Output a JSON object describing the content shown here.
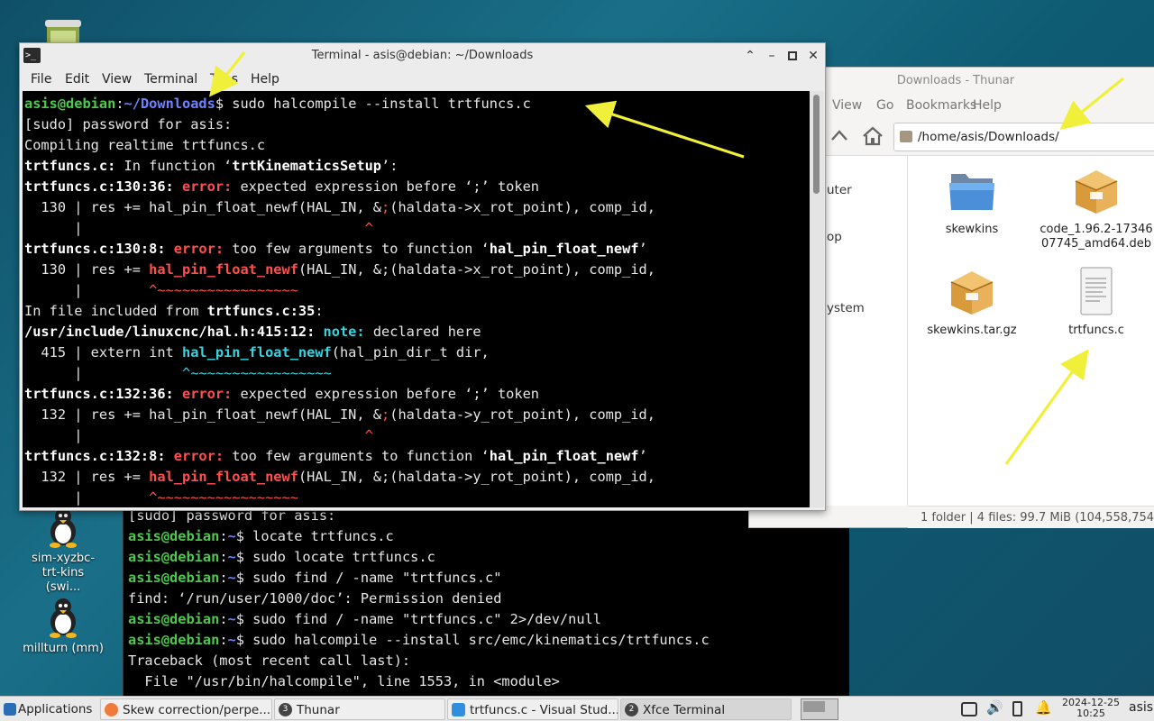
{
  "terminal": {
    "title": "Terminal - asis@debian: ~/Downloads",
    "menu": [
      "File",
      "Edit",
      "View",
      "Terminal",
      "Tabs",
      "Help"
    ]
  },
  "thunar": {
    "title": "Downloads - Thunar",
    "menu": [
      "View",
      "Go",
      "Bookmarks",
      "Help"
    ],
    "path": "/home/asis/Downloads/",
    "sidebar": [
      "uter",
      "op",
      "ystem"
    ],
    "files": [
      {
        "name": "skewkins",
        "icon": "folder-icon"
      },
      {
        "name": "code_1.96.2-1734607745_amd64.deb",
        "display": "code_1.96.2-17346\n07745_amd64.deb",
        "icon": "package-icon"
      },
      {
        "name": "skewkins.tar.gz",
        "icon": "package-icon"
      },
      {
        "name": "trtfuncs.c",
        "icon": "text-file-icon"
      }
    ],
    "status": "1 folder  |  4 files: 99.7 MiB (104,558,754"
  },
  "desktop_icons": [
    {
      "label": "sim-xyzbc-trt-kins (swi..."
    },
    {
      "label": "millturn (mm)"
    }
  ],
  "taskbar": {
    "applications": "Applications",
    "items": [
      {
        "label": "Skew correction/perpe...",
        "icon": "firefox-icon"
      },
      {
        "label": "Thunar",
        "badge": "3"
      },
      {
        "label": "trtfuncs.c - Visual Stud...",
        "icon": "vscode-icon"
      },
      {
        "label": "Xfce Terminal",
        "badge": "2"
      }
    ],
    "date": "2024-12-25",
    "time": "10:25",
    "user": "asis"
  },
  "colors": {
    "prompt_user": "#4ec94e",
    "prompt_path": "#6f82ff",
    "error": "#ff4f4f",
    "note": "#38d3e0",
    "arrow": "#f0f03a"
  },
  "terminal_lines": [
    [
      [
        "asis@debian",
        "g"
      ],
      [
        ":",
        ""
      ],
      [
        "~/Downloads",
        "b"
      ],
      [
        "$ sudo halcompile --install trtfuncs.c",
        ""
      ]
    ],
    [
      [
        "[sudo] password for asis:",
        ""
      ]
    ],
    [
      [
        "Compiling realtime trtfuncs.c",
        ""
      ]
    ],
    [
      [
        "trtfuncs.c:",
        "bw"
      ],
      [
        " In function ‘",
        ""
      ],
      [
        "trtKinematicsSetup",
        "bw"
      ],
      [
        "’:",
        ""
      ]
    ],
    [
      [
        "trtfuncs.c:130:36: ",
        "bw"
      ],
      [
        "error:",
        "r"
      ],
      [
        " expected expression before ‘;’ token",
        ""
      ]
    ],
    [
      [
        "  130 | res += hal_pin_float_newf(HAL_IN, &",
        ""
      ],
      [
        ";",
        "rn"
      ],
      [
        "(haldata->x_rot_point), comp_id,",
        ""
      ]
    ],
    [
      [
        "      |                                  ",
        ""
      ],
      [
        "^",
        "rn"
      ]
    ],
    [
      [
        "trtfuncs.c:130:8: ",
        "bw"
      ],
      [
        "error:",
        "r"
      ],
      [
        " too few arguments to function ‘",
        ""
      ],
      [
        "hal_pin_float_newf",
        "bw"
      ],
      [
        "’",
        ""
      ]
    ],
    [
      [
        "  130 | res += ",
        ""
      ],
      [
        "hal_pin_float_newf",
        "r"
      ],
      [
        "(HAL_IN, &;(haldata->x_rot_point), comp_id,",
        ""
      ]
    ],
    [
      [
        "      |        ",
        ""
      ],
      [
        "^~~~~~~~~~~~~~~~~~",
        "rn"
      ]
    ],
    [
      [
        "In file included from ",
        ""
      ],
      [
        "trtfuncs.c:35",
        "bw"
      ],
      [
        ":",
        ""
      ]
    ],
    [
      [
        "/usr/include/linuxcnc/hal.h:415:12: ",
        "bw"
      ],
      [
        "note:",
        "c"
      ],
      [
        " declared here",
        ""
      ]
    ],
    [
      [
        "  415 | extern int ",
        ""
      ],
      [
        "hal_pin_float_newf",
        "c"
      ],
      [
        "(hal_pin_dir_t dir,",
        ""
      ]
    ],
    [
      [
        "      |            ",
        ""
      ],
      [
        "^~~~~~~~~~~~~~~~~~",
        "cn"
      ]
    ],
    [
      [
        "trtfuncs.c:132:36: ",
        "bw"
      ],
      [
        "error:",
        "r"
      ],
      [
        " expected expression before ‘;’ token",
        ""
      ]
    ],
    [
      [
        "  132 | res += hal_pin_float_newf(HAL_IN, &",
        ""
      ],
      [
        ";",
        "rn"
      ],
      [
        "(haldata->y_rot_point), comp_id,",
        ""
      ]
    ],
    [
      [
        "      |                                  ",
        ""
      ],
      [
        "^",
        "rn"
      ]
    ],
    [
      [
        "trtfuncs.c:132:8: ",
        "bw"
      ],
      [
        "error:",
        "r"
      ],
      [
        " too few arguments to function ‘",
        ""
      ],
      [
        "hal_pin_float_newf",
        "bw"
      ],
      [
        "’",
        ""
      ]
    ],
    [
      [
        "  132 | res += ",
        ""
      ],
      [
        "hal_pin_float_newf",
        "r"
      ],
      [
        "(HAL_IN, &;(haldata->y_rot_point), comp_id,",
        ""
      ]
    ],
    [
      [
        "      |        ",
        ""
      ],
      [
        "^~~~~~~~~~~~~~~~~~",
        "rn"
      ]
    ]
  ],
  "background_terminal_lines": [
    [
      [
        "[sudo] password for asis:",
        ""
      ]
    ],
    [
      [
        "asis@debian",
        "g"
      ],
      [
        ":",
        ""
      ],
      [
        "~",
        "b"
      ],
      [
        "$ locate trtfuncs.c",
        ""
      ]
    ],
    [
      [
        "asis@debian",
        "g"
      ],
      [
        ":",
        ""
      ],
      [
        "~",
        "b"
      ],
      [
        "$ sudo locate trtfuncs.c",
        ""
      ]
    ],
    [
      [
        "asis@debian",
        "g"
      ],
      [
        ":",
        ""
      ],
      [
        "~",
        "b"
      ],
      [
        "$ sudo find / -name \"trtfuncs.c\"",
        ""
      ]
    ],
    [
      [
        "find: ‘/run/user/1000/doc’: Permission denied",
        ""
      ]
    ],
    [
      [
        "asis@debian",
        "g"
      ],
      [
        ":",
        ""
      ],
      [
        "~",
        "b"
      ],
      [
        "$ sudo find / -name \"trtfuncs.c\" 2>/dev/null",
        ""
      ]
    ],
    [
      [
        "asis@debian",
        "g"
      ],
      [
        ":",
        ""
      ],
      [
        "~",
        "b"
      ],
      [
        "$ sudo halcompile --install src/emc/kinematics/trtfuncs.c",
        ""
      ]
    ],
    [
      [
        "Traceback (most recent call last):",
        ""
      ]
    ],
    [
      [
        "  File \"/usr/bin/halcompile\", line 1553, in <module>",
        ""
      ]
    ]
  ]
}
